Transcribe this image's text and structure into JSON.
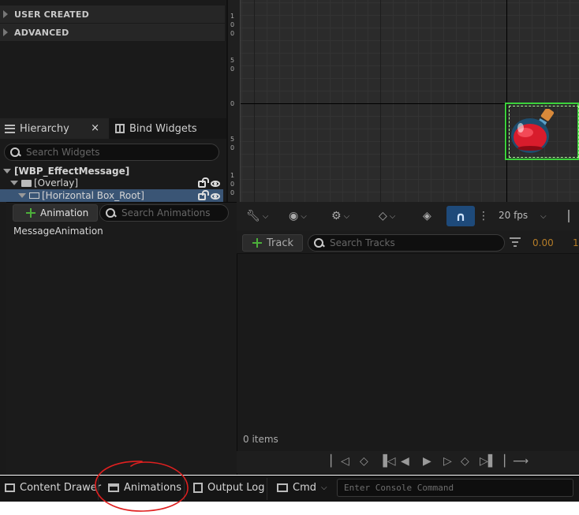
{
  "palette": {
    "categories": [
      {
        "label": "USER CREATED"
      },
      {
        "label": "ADVANCED"
      }
    ]
  },
  "hierarchy": {
    "tabs": [
      {
        "label": "Hierarchy"
      },
      {
        "label": "Bind Widgets"
      }
    ],
    "close_glyph": "×",
    "search_placeholder": "Search Widgets",
    "tree": [
      {
        "label": "[WBP_EffectMessage]"
      },
      {
        "label": "[Overlay]"
      },
      {
        "label": "[Horizontal Box_Root]"
      }
    ]
  },
  "ruler": {
    "labels": [
      "1",
      "0",
      "0",
      "5",
      "0",
      "0",
      "5",
      "0",
      "1",
      "0",
      "0"
    ]
  },
  "animations": {
    "add_label": "Animation",
    "search_placeholder": "Search Animations",
    "items": [
      {
        "label": "MessageAnimation"
      }
    ]
  },
  "sequencer": {
    "fps_label": "20 fps",
    "track_label": "Track",
    "search_placeholder": "Search Tracks",
    "time_value": "0.00",
    "time_value_next": "1",
    "items_count": "0 items"
  },
  "bottom_bar": {
    "content_drawer": "Content Drawer",
    "animations": "Animations",
    "output_log": "Output Log",
    "cmd": "Cmd",
    "console_placeholder": "Enter Console Command"
  },
  "colors": {
    "selection": "#3bd13b",
    "accent_blue": "#1e4a7a",
    "add_green": "#4caf3a",
    "time_orange": "#b57d28",
    "annotation_red": "#e02020"
  }
}
